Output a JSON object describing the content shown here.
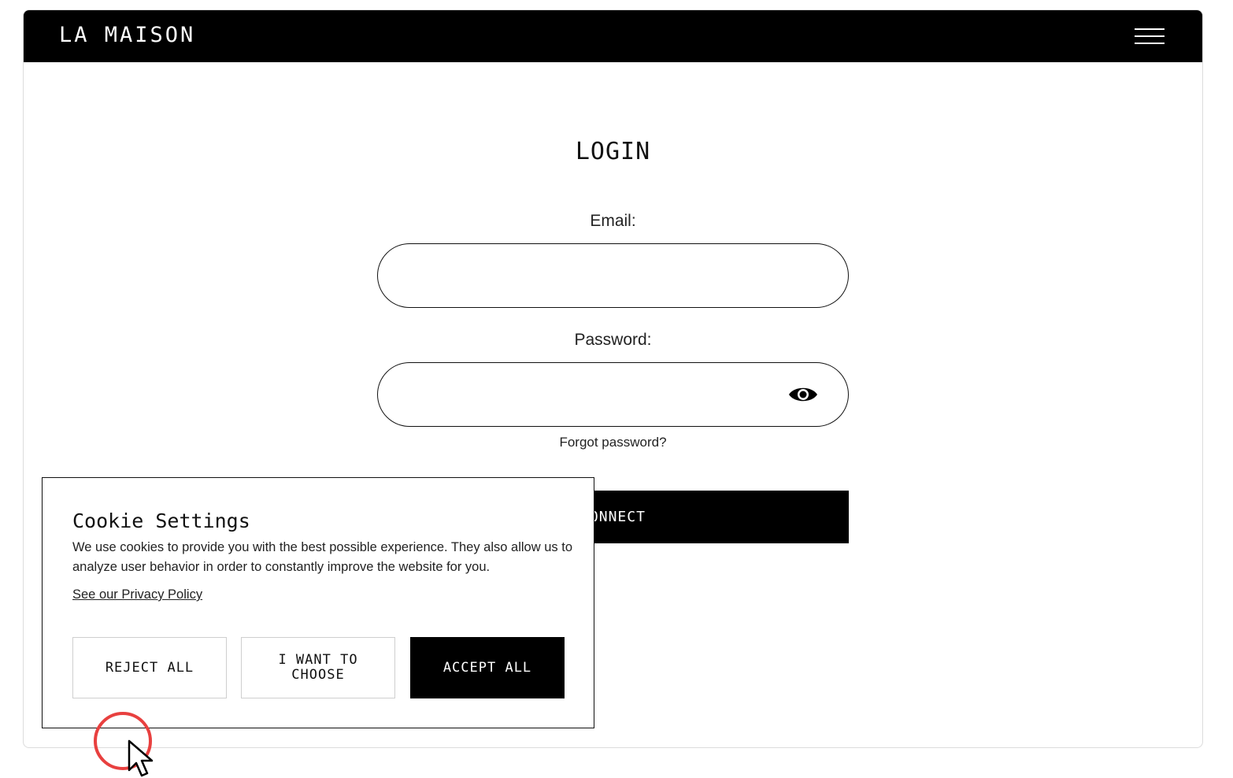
{
  "header": {
    "brand": "LA MAISON",
    "menu_icon": "hamburger-menu-icon"
  },
  "login": {
    "title": "LOGIN",
    "email_label": "Email:",
    "email_value": "",
    "password_label": "Password:",
    "password_value": "",
    "password_toggle_icon": "eye-icon",
    "forgot_password": "Forgot password?",
    "connect_button": "CONNECT"
  },
  "cookie_banner": {
    "title": "Cookie Settings",
    "text": "We use cookies to provide you with the best possible experience. They also allow us to analyze user behavior in order to constantly improve the website for you.",
    "privacy_link": "See our Privacy Policy",
    "reject_button": "REJECT ALL",
    "choose_button": "I WANT TO CHOOSE",
    "accept_button": "ACCEPT ALL"
  },
  "colors": {
    "header_bg": "#000000",
    "accent": "#000000",
    "cursor_ring": "#e8403f"
  }
}
